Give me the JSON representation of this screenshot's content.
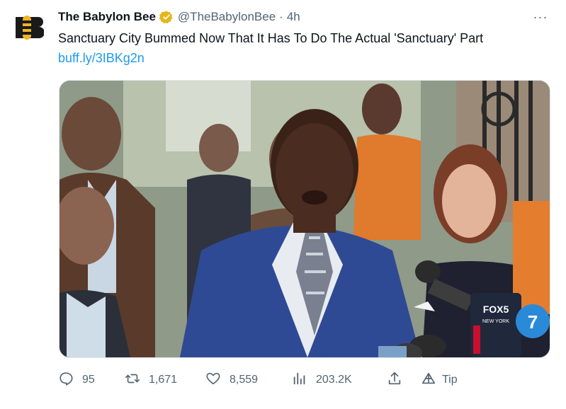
{
  "tweet": {
    "author_name": "The Babylon Bee",
    "handle": "@TheBabylonBee",
    "separator": "·",
    "time": "4h",
    "more_label": "···",
    "text": "Sanctuary City Bummed Now That It Has To Do The Actual 'Sanctuary' Part",
    "link": "buff.ly/3IBKg2n",
    "media_mic_label": "FOX5",
    "media_mic_sub": "NEW YORK",
    "media_mic_label2": "FOX5",
    "media_logo_num": "7"
  },
  "actions": {
    "replies": "95",
    "retweets": "1,671",
    "likes": "8,559",
    "views": "203.2K",
    "tip_label": "Tip"
  },
  "colors": {
    "accent": "#1d9bf0",
    "text": "#0f1419",
    "muted": "#536471",
    "verified_gold": "#e2b719"
  },
  "icons": [
    "babylon-bee-logo-icon",
    "verified-badge-icon",
    "more-icon",
    "reply-icon",
    "retweet-icon",
    "like-icon",
    "views-icon",
    "share-icon",
    "tip-icon"
  ]
}
